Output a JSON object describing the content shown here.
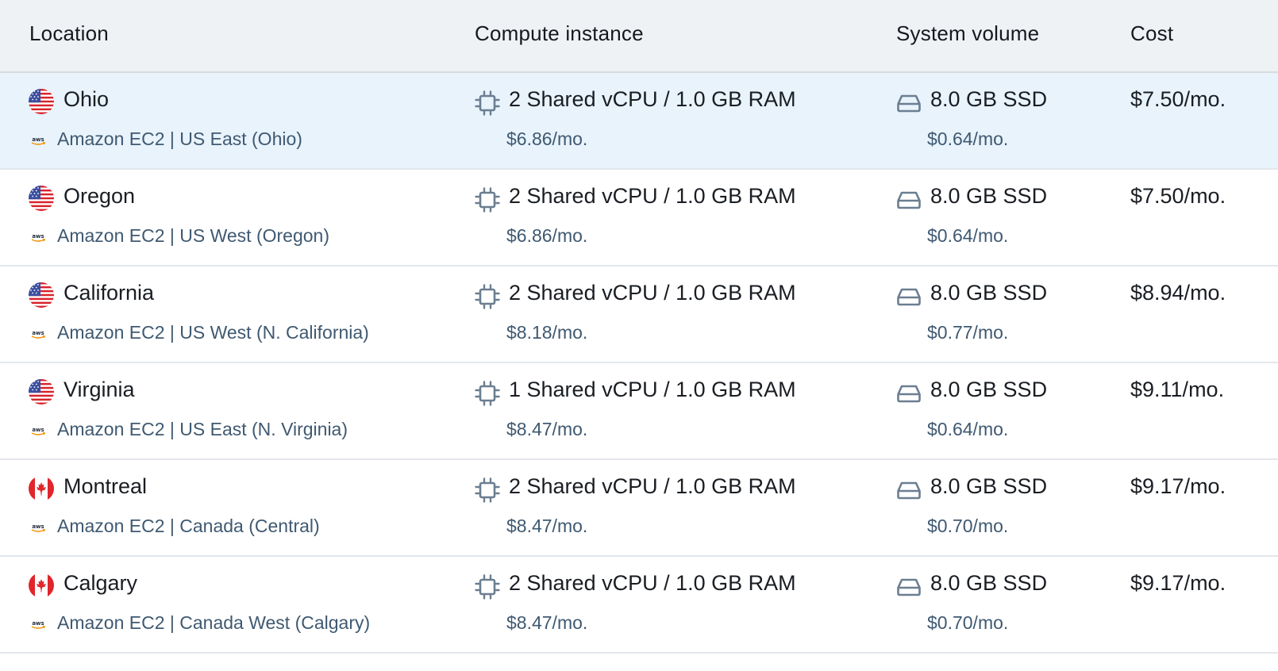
{
  "header": {
    "location": "Location",
    "compute": "Compute instance",
    "volume": "System volume",
    "cost": "Cost"
  },
  "rows": [
    {
      "location": "Ohio",
      "flag": "us-flag-icon",
      "provider": "Amazon EC2 | US East (Ohio)",
      "compute": "2 Shared vCPU / 1.0 GB RAM",
      "compute_cost": "$6.86/mo.",
      "volume": "8.0 GB SSD",
      "volume_cost": "$0.64/mo.",
      "cost": "$7.50/mo.",
      "selected": true
    },
    {
      "location": "Oregon",
      "flag": "us-flag-icon",
      "provider": "Amazon EC2 | US West (Oregon)",
      "compute": "2 Shared vCPU / 1.0 GB RAM",
      "compute_cost": "$6.86/mo.",
      "volume": "8.0 GB SSD",
      "volume_cost": "$0.64/mo.",
      "cost": "$7.50/mo."
    },
    {
      "location": "California",
      "flag": "us-flag-icon",
      "provider": "Amazon EC2 | US West (N. California)",
      "compute": "2 Shared vCPU / 1.0 GB RAM",
      "compute_cost": "$8.18/mo.",
      "volume": "8.0 GB SSD",
      "volume_cost": "$0.77/mo.",
      "cost": "$8.94/mo."
    },
    {
      "location": "Virginia",
      "flag": "us-flag-icon",
      "provider": "Amazon EC2 | US East (N. Virginia)",
      "compute": "1 Shared vCPU / 1.0 GB RAM",
      "compute_cost": "$8.47/mo.",
      "volume": "8.0 GB SSD",
      "volume_cost": "$0.64/mo.",
      "cost": "$9.11/mo."
    },
    {
      "location": "Montreal",
      "flag": "ca-flag-icon",
      "provider": "Amazon EC2 | Canada (Central)",
      "compute": "2 Shared vCPU / 1.0 GB RAM",
      "compute_cost": "$8.47/mo.",
      "volume": "8.0 GB SSD",
      "volume_cost": "$0.70/mo.",
      "cost": "$9.17/mo."
    },
    {
      "location": "Calgary",
      "flag": "ca-flag-icon",
      "provider": "Amazon EC2 | Canada West (Calgary)",
      "compute": "2 Shared vCPU / 1.0 GB RAM",
      "compute_cost": "$8.47/mo.",
      "volume": "8.0 GB SSD",
      "volume_cost": "$0.70/mo.",
      "cost": "$9.17/mo."
    }
  ],
  "colors": {
    "header_bg": "#eff2f5",
    "selected_row_bg": "#e8f3fc",
    "secondary_text": "#3f5971",
    "icon": "#6b7e91"
  }
}
